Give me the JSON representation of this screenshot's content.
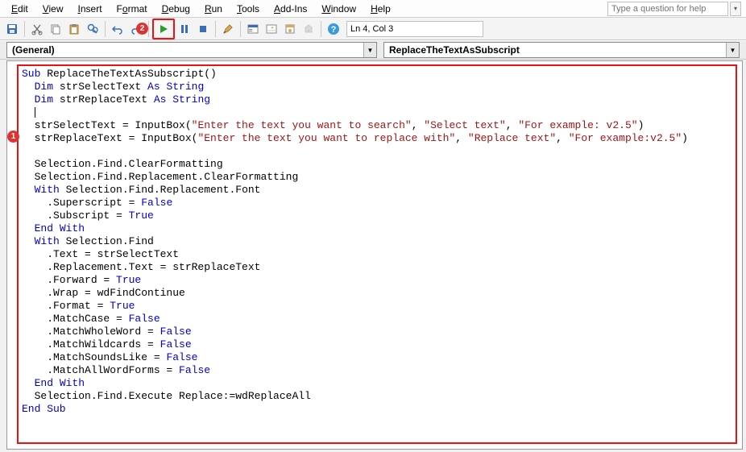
{
  "menu": {
    "edit": "Edit",
    "view": "View",
    "insert": "Insert",
    "format": "Format",
    "debug": "Debug",
    "run": "Run",
    "tools": "Tools",
    "addins": "Add-Ins",
    "window": "Window",
    "help": "Help"
  },
  "help_search_placeholder": "Type a question for help",
  "status_pos": "Ln 4, Col 3",
  "annotations": {
    "badge1": "1",
    "badge2": "2"
  },
  "object_dropdown": "(General)",
  "procedure_dropdown": "ReplaceTheTextAsSubscript",
  "code_lines": [
    {
      "indent": 0,
      "tokens": [
        [
          "kw",
          "Sub"
        ],
        [
          "",
          " ReplaceTheTextAsSubscript()"
        ]
      ]
    },
    {
      "indent": 1,
      "tokens": [
        [
          "kw",
          "Dim"
        ],
        [
          "",
          " strSelectText "
        ],
        [
          "kw",
          "As String"
        ]
      ]
    },
    {
      "indent": 1,
      "tokens": [
        [
          "kw",
          "Dim"
        ],
        [
          "",
          " strReplaceText "
        ],
        [
          "kw",
          "As String"
        ]
      ]
    },
    {
      "indent": 1,
      "tokens": [
        [
          "cursor",
          ""
        ]
      ]
    },
    {
      "indent": 1,
      "tokens": [
        [
          "",
          "strSelectText = InputBox("
        ],
        [
          "str",
          "\"Enter the text you want to search\""
        ],
        [
          "",
          ", "
        ],
        [
          "str",
          "\"Select text\""
        ],
        [
          "",
          ", "
        ],
        [
          "str",
          "\"For example: v2.5\""
        ],
        [
          "",
          ")"
        ]
      ]
    },
    {
      "indent": 1,
      "tokens": [
        [
          "",
          "strReplaceText = InputBox("
        ],
        [
          "str",
          "\"Enter the text you want to replace with\""
        ],
        [
          "",
          ", "
        ],
        [
          "str",
          "\"Replace text\""
        ],
        [
          "",
          ", "
        ],
        [
          "str",
          "\"For example:v2.5\""
        ],
        [
          "",
          ")"
        ]
      ]
    },
    {
      "indent": 0,
      "tokens": [
        [
          "",
          ""
        ]
      ]
    },
    {
      "indent": 1,
      "tokens": [
        [
          "",
          "Selection.Find.ClearFormatting"
        ]
      ]
    },
    {
      "indent": 1,
      "tokens": [
        [
          "",
          "Selection.Find.Replacement.ClearFormatting"
        ]
      ]
    },
    {
      "indent": 1,
      "tokens": [
        [
          "kw",
          "With"
        ],
        [
          "",
          " Selection.Find.Replacement.Font"
        ]
      ]
    },
    {
      "indent": 2,
      "tokens": [
        [
          "",
          ".Superscript = "
        ],
        [
          "kw",
          "False"
        ]
      ]
    },
    {
      "indent": 2,
      "tokens": [
        [
          "",
          ".Subscript = "
        ],
        [
          "kw",
          "True"
        ]
      ]
    },
    {
      "indent": 1,
      "tokens": [
        [
          "kw",
          "End With"
        ]
      ]
    },
    {
      "indent": 1,
      "tokens": [
        [
          "kw",
          "With"
        ],
        [
          "",
          " Selection.Find"
        ]
      ]
    },
    {
      "indent": 2,
      "tokens": [
        [
          "",
          ".Text = strSelectText"
        ]
      ]
    },
    {
      "indent": 2,
      "tokens": [
        [
          "",
          ".Replacement.Text = strReplaceText"
        ]
      ]
    },
    {
      "indent": 2,
      "tokens": [
        [
          "",
          ".Forward = "
        ],
        [
          "kw",
          "True"
        ]
      ]
    },
    {
      "indent": 2,
      "tokens": [
        [
          "",
          ".Wrap = wdFindContinue"
        ]
      ]
    },
    {
      "indent": 2,
      "tokens": [
        [
          "",
          ".Format = "
        ],
        [
          "kw",
          "True"
        ]
      ]
    },
    {
      "indent": 2,
      "tokens": [
        [
          "",
          ".MatchCase = "
        ],
        [
          "kw",
          "False"
        ]
      ]
    },
    {
      "indent": 2,
      "tokens": [
        [
          "",
          ".MatchWholeWord = "
        ],
        [
          "kw",
          "False"
        ]
      ]
    },
    {
      "indent": 2,
      "tokens": [
        [
          "",
          ".MatchWildcards = "
        ],
        [
          "kw",
          "False"
        ]
      ]
    },
    {
      "indent": 2,
      "tokens": [
        [
          "",
          ".MatchSoundsLike = "
        ],
        [
          "kw",
          "False"
        ]
      ]
    },
    {
      "indent": 2,
      "tokens": [
        [
          "",
          ".MatchAllWordForms = "
        ],
        [
          "kw",
          "False"
        ]
      ]
    },
    {
      "indent": 1,
      "tokens": [
        [
          "kw",
          "End With"
        ]
      ]
    },
    {
      "indent": 1,
      "tokens": [
        [
          "",
          "Selection.Find.Execute Replace:=wdReplaceAll"
        ]
      ]
    },
    {
      "indent": 0,
      "tokens": [
        [
          "kw",
          "End Sub"
        ]
      ]
    }
  ]
}
